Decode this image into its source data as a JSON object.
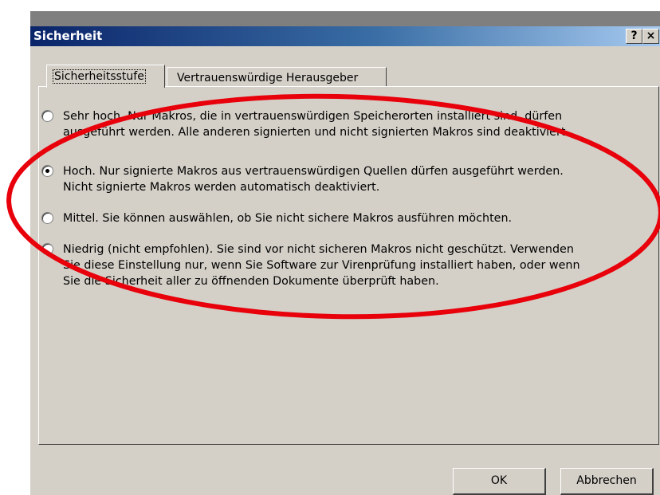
{
  "window": {
    "title": "Sicherheit",
    "help_glyph": "?",
    "close_glyph": "×"
  },
  "tabs": [
    {
      "label": "Sicherheitsstufe",
      "selected": true
    },
    {
      "label": "Vertrauenswürdige Herausgeber",
      "selected": false
    }
  ],
  "options": [
    {
      "lines": [
        "Sehr hoch. Nur Makros, die in vertrauenswürdigen Speicherorten installiert sind, dürfen",
        "ausgeführt werden. Alle anderen signierten und nicht signierten Makros sind deaktiviert."
      ],
      "selected": false
    },
    {
      "lines": [
        "Hoch. Nur signierte Makros aus vertrauenswürdigen Quellen dürfen ausgeführt werden.",
        "Nicht signierte Makros werden automatisch deaktiviert."
      ],
      "selected": true
    },
    {
      "lines": [
        "Mittel. Sie können auswählen, ob Sie nicht sichere Makros ausführen möchten."
      ],
      "selected": false
    },
    {
      "lines": [
        "Niedrig (nicht empfohlen). Sie sind vor nicht sicheren Makros nicht geschützt. Verwenden",
        "Sie diese Einstellung nur, wenn Sie Software zur Virenprüfung installiert haben, oder wenn",
        "Sie die Sicherheit aller zu öffnenden Dokumente überprüft haben."
      ],
      "selected": false
    }
  ],
  "buttons": {
    "ok": "OK",
    "cancel": "Abbrechen"
  },
  "annotation": {
    "color": "#e8000b"
  }
}
